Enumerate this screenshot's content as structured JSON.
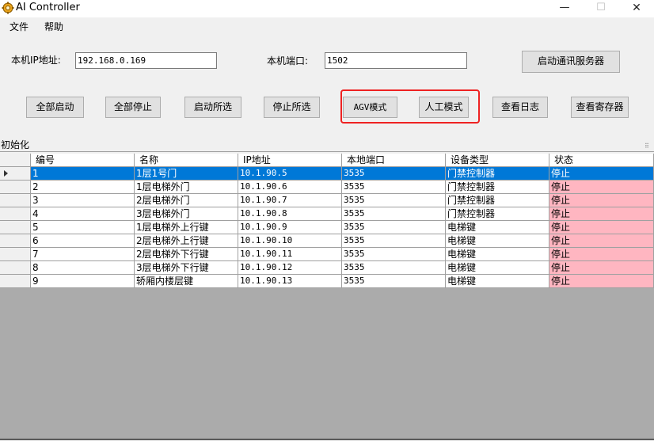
{
  "window": {
    "title": "AI Controller",
    "minimize": "—",
    "maximize": "☐",
    "close": "✕"
  },
  "menu": [
    "文件",
    "帮助"
  ],
  "config": {
    "ip_label": "本机IP地址:",
    "ip_value": "192.168.0.169",
    "port_label": "本机端口:",
    "port_value": "1502",
    "start_server_button": "启动通讯服务器"
  },
  "toolbar": {
    "start_all": "全部启动",
    "stop_all": "全部停止",
    "start_selected": "启动所选",
    "stop_selected": "停止所选",
    "agv_mode": "AGV模式",
    "manual_mode": "人工模式",
    "view_log": "查看日志",
    "view_registers": "查看寄存器"
  },
  "panel": {
    "caption": "初始化",
    "grip": "⠿"
  },
  "table": {
    "columns": [
      "编号",
      "名称",
      "IP地址",
      "本地端口",
      "设备类型",
      "状态"
    ],
    "selected_row": 0,
    "rows": [
      {
        "id": "1",
        "name": "1层1号门",
        "ip": "10.1.90.5",
        "port": "3535",
        "type": "门禁控制器",
        "status": "停止"
      },
      {
        "id": "2",
        "name": "1层电梯外门",
        "ip": "10.1.90.6",
        "port": "3535",
        "type": "门禁控制器",
        "status": "停止"
      },
      {
        "id": "3",
        "name": "2层电梯外门",
        "ip": "10.1.90.7",
        "port": "3535",
        "type": "门禁控制器",
        "status": "停止"
      },
      {
        "id": "4",
        "name": "3层电梯外门",
        "ip": "10.1.90.8",
        "port": "3535",
        "type": "门禁控制器",
        "status": "停止"
      },
      {
        "id": "5",
        "name": "1层电梯外上行键",
        "ip": "10.1.90.9",
        "port": "3535",
        "type": "电梯键",
        "status": "停止"
      },
      {
        "id": "6",
        "name": "2层电梯外上行键",
        "ip": "10.1.90.10",
        "port": "3535",
        "type": "电梯键",
        "status": "停止"
      },
      {
        "id": "7",
        "name": "2层电梯外下行键",
        "ip": "10.1.90.11",
        "port": "3535",
        "type": "电梯键",
        "status": "停止"
      },
      {
        "id": "8",
        "name": "3层电梯外下行键",
        "ip": "10.1.90.12",
        "port": "3535",
        "type": "电梯键",
        "status": "停止"
      },
      {
        "id": "9",
        "name": "轿厢内楼层键",
        "ip": "10.1.90.13",
        "port": "3535",
        "type": "电梯键",
        "status": "停止"
      }
    ],
    "status_color": "#ffb6c1",
    "selection_color": "#0078d7"
  }
}
